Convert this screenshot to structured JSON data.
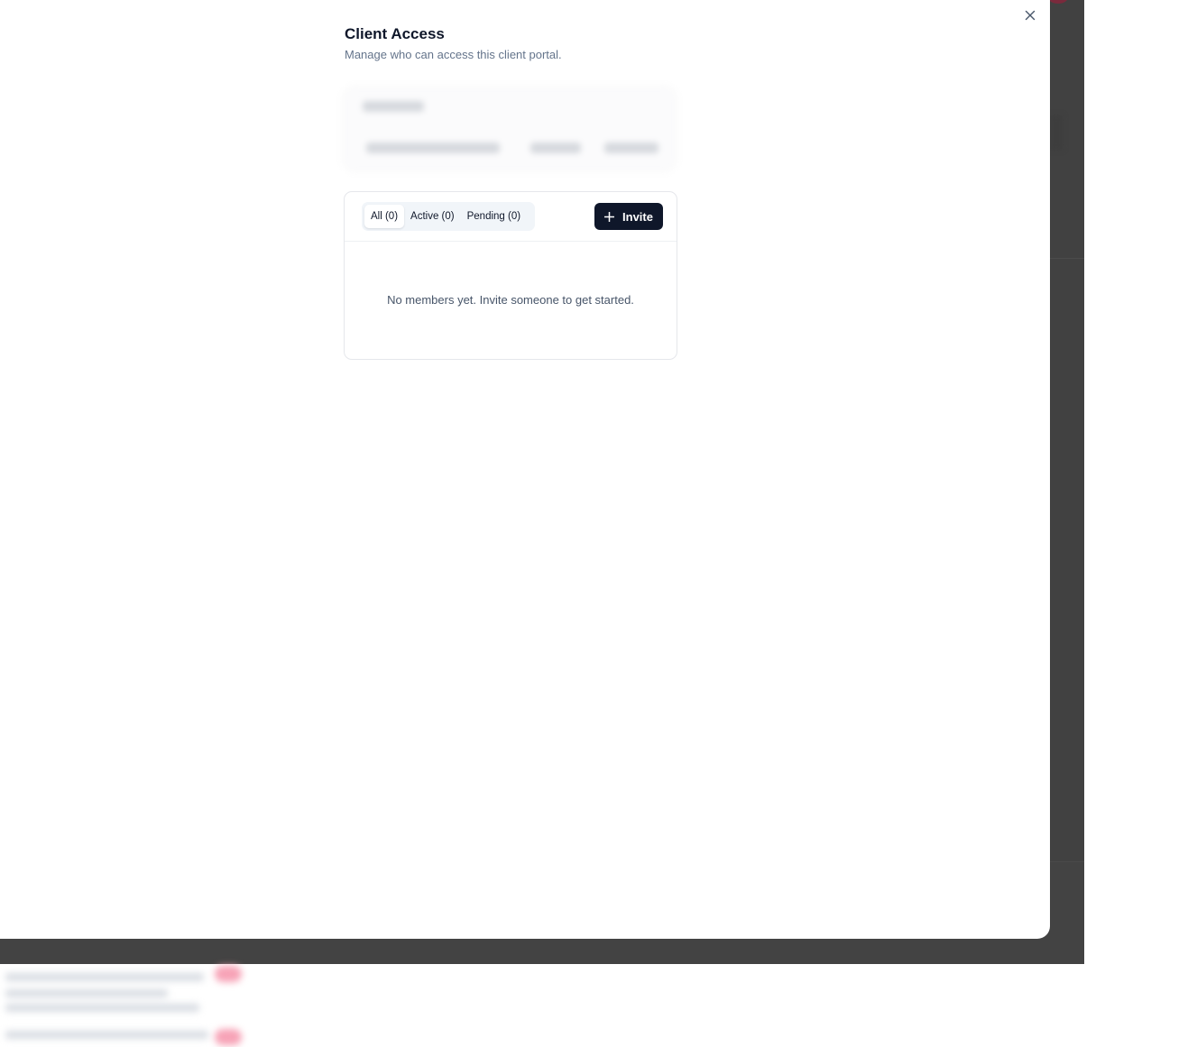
{
  "modal": {
    "title": "Client Access",
    "subtitle": "Manage who can access this client portal.",
    "close_icon": "close-icon"
  },
  "members": {
    "tabs": [
      {
        "label": "All (0)",
        "active": true
      },
      {
        "label": "Active (0)",
        "active": false
      },
      {
        "label": "Pending (0)",
        "active": false
      }
    ],
    "invite_button": {
      "label": "Invite",
      "icon": "plus-icon"
    },
    "empty_message": "No members yet. Invite someone to get started."
  },
  "colors": {
    "backdrop": "#434343",
    "primary_button": "#0f172a",
    "muted_text": "#64748b",
    "tab_track": "#f1f5f9"
  }
}
